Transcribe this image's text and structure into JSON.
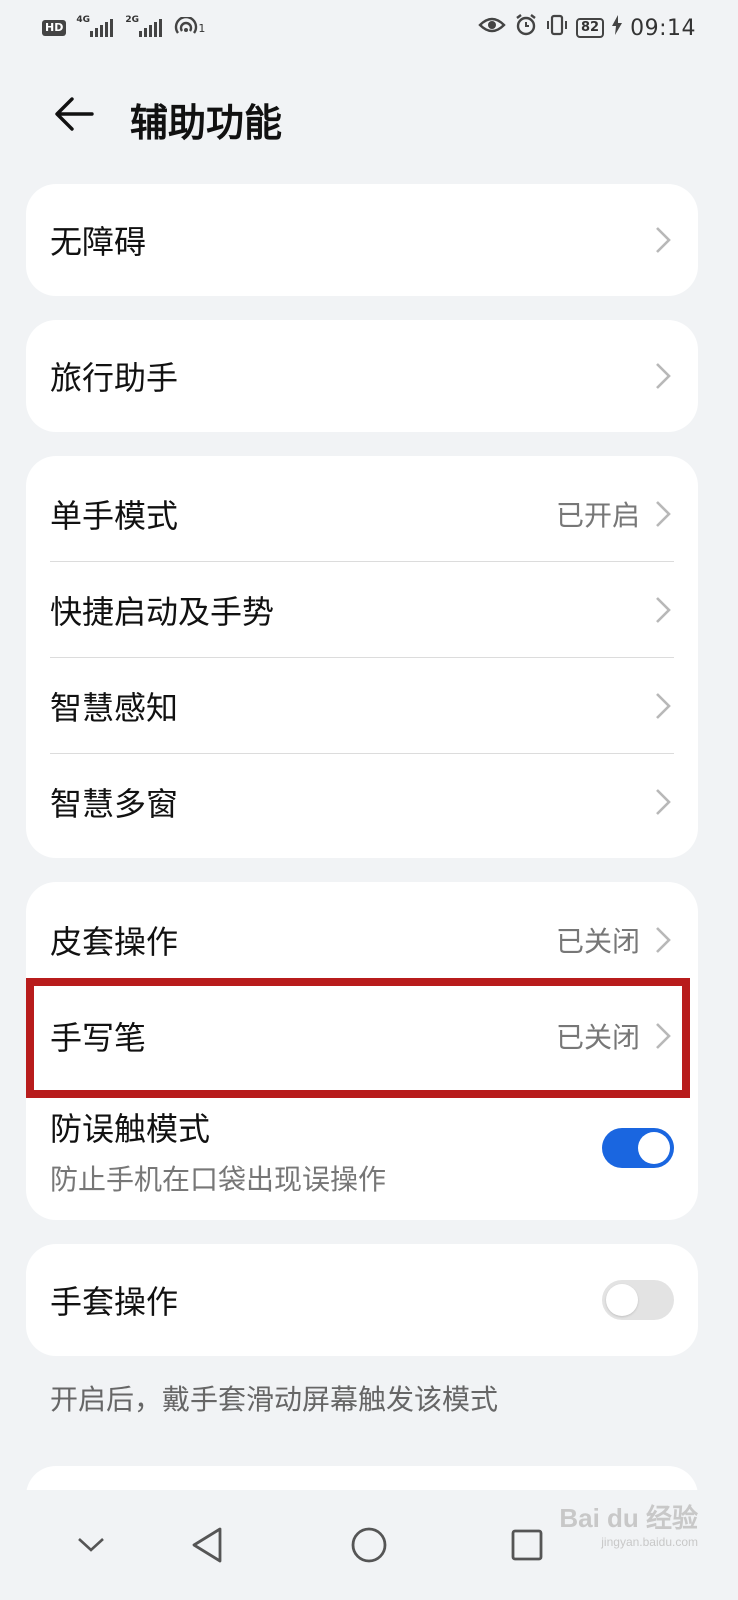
{
  "status_bar": {
    "hd": "HD",
    "sim1": "4G",
    "sim2": "2G",
    "hotspot_count": "1",
    "battery": "82",
    "time": "09:14"
  },
  "header": {
    "title": "辅助功能",
    "back_icon": "back-arrow-icon"
  },
  "groups": [
    {
      "items": [
        {
          "label": "无障碍",
          "value": ""
        }
      ]
    },
    {
      "items": [
        {
          "label": "旅行助手",
          "value": ""
        }
      ]
    },
    {
      "items": [
        {
          "label": "单手模式",
          "value": "已开启"
        },
        {
          "label": "快捷启动及手势",
          "value": ""
        },
        {
          "label": "智慧感知",
          "value": ""
        },
        {
          "label": "智慧多窗",
          "value": ""
        }
      ]
    },
    {
      "items": [
        {
          "label": "皮套操作",
          "value": "已关闭"
        },
        {
          "label": "手写笔",
          "value": "已关闭"
        },
        {
          "label": "防误触模式",
          "sublabel": "防止手机在口袋出现误操作",
          "toggle": true
        }
      ]
    },
    {
      "items": [
        {
          "label": "手套操作",
          "toggle": false
        }
      ]
    }
  ],
  "footnote": "开启后，戴手套滑动屏幕触发该模式",
  "highlight_color": "#b81c1c",
  "accent_color": "#1a66e0",
  "navbar": [
    "chevron-down-icon",
    "back-triangle-icon",
    "home-circle-icon",
    "recents-square-icon"
  ],
  "watermark": {
    "text": "Bai du 经验",
    "sub": "jingyan.baidu.com"
  }
}
